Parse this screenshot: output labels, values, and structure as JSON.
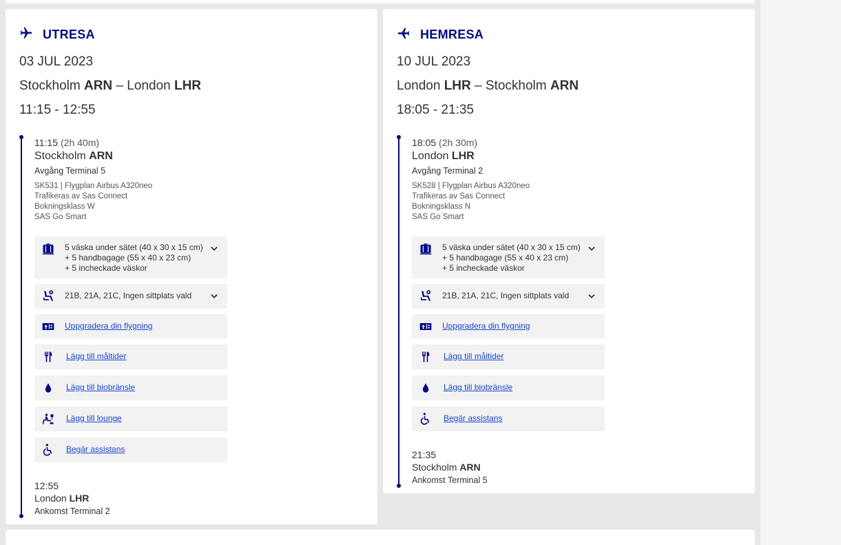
{
  "outbound": {
    "heading": "UTRESA",
    "date": "03 JUL 2023",
    "route": {
      "from_city": "Stockholm",
      "from_code": "ARN",
      "sep": "–",
      "to_city": "London",
      "to_code": "LHR"
    },
    "times": "11:15 - 12:55",
    "departure": {
      "time": "11:15",
      "duration": "(2h 40m)",
      "city": "Stockholm",
      "code": "ARN",
      "terminal": "Avgång Terminal 5",
      "flight": "SK531 | Flygplan Airbus A320neo",
      "operator": "Trafikeras av Sas Connect",
      "booking_class": "Bokningsklass W",
      "fare": "SAS Go Smart"
    },
    "services": {
      "baggage": [
        "5 väska under sätet (40 x 30 x 15 cm)",
        "+ 5 handbagage (55 x 40 x 23 cm)",
        "+ 5 incheckade väskor"
      ],
      "seats": "21B, 21A, 21C, Ingen sittplats vald",
      "upgrade": "Uppgradera din flygning",
      "meals": "Lägg till måltider",
      "biofuel": "Lägg till biobränsle",
      "lounge": "Lägg till lounge",
      "assistance": "Begär assistans"
    },
    "arrival": {
      "time": "12:55",
      "city": "London",
      "code": "LHR",
      "terminal": "Ankomst Terminal 2"
    }
  },
  "return": {
    "heading": "HEMRESA",
    "date": "10 JUL 2023",
    "route": {
      "from_city": "London",
      "from_code": "LHR",
      "sep": "–",
      "to_city": "Stockholm",
      "to_code": "ARN"
    },
    "times": "18:05 - 21:35",
    "departure": {
      "time": "18:05",
      "duration": "(2h 30m)",
      "city": "London",
      "code": "LHR",
      "terminal": "Avgång Terminal 2",
      "flight": "SK528 | Flygplan Airbus A320neo",
      "operator": "Trafikeras av Sas Connect",
      "booking_class": "Bokningsklass N",
      "fare": "SAS Go Smart"
    },
    "services": {
      "baggage": [
        "5 väska under sätet (40 x 30 x 15 cm)",
        "+ 5 handbagage (55 x 40 x 23 cm)",
        "+ 5 incheckade väskor"
      ],
      "seats": "21B, 21A, 21C, Ingen sittplats vald",
      "upgrade": "Uppgradera din flygning",
      "meals": "Lägg till måltider",
      "biofuel": "Lägg till biobränsle",
      "assistance": "Begär assistans"
    },
    "arrival": {
      "time": "21:35",
      "city": "Stockholm",
      "code": "ARN",
      "terminal": "Ankomst Terminal 5"
    }
  },
  "icons": {
    "plane_departure": "plane-departure-icon",
    "plane_arrival": "plane-arrival-icon",
    "baggage": "suitcase-icon",
    "seat": "seat-icon",
    "upgrade": "upgrade-ticket-icon",
    "meals": "fork-knife-icon",
    "biofuel": "drop-icon",
    "lounge": "lounge-icon",
    "assistance": "wheelchair-icon",
    "expand": "chevron-down-icon"
  },
  "colors": {
    "brand": "#000b8c",
    "link": "#1a48d6",
    "service_bg": "#f2f2f2",
    "page_bg": "#e8e8e8"
  }
}
